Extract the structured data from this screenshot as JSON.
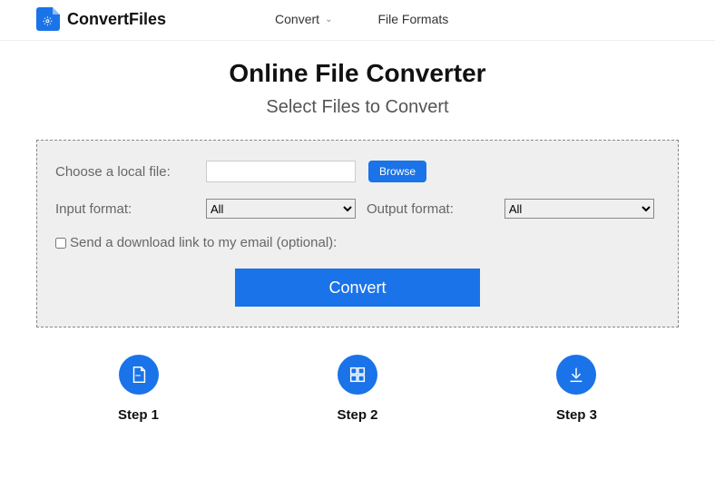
{
  "logo": {
    "text": "ConvertFiles"
  },
  "nav": {
    "convert": "Convert",
    "formats": "File Formats"
  },
  "hero": {
    "title": "Online File Converter",
    "subtitle": "Select Files to Convert"
  },
  "form": {
    "choose_label": "Choose a local file:",
    "browse": "Browse",
    "input_format_label": "Input format:",
    "input_format_value": "All",
    "output_format_label": "Output format:",
    "output_format_value": "All",
    "email_check": "Send a download link to my email (optional):",
    "convert": "Convert"
  },
  "steps": {
    "s1": "Step 1",
    "s2": "Step 2",
    "s3": "Step 3"
  }
}
